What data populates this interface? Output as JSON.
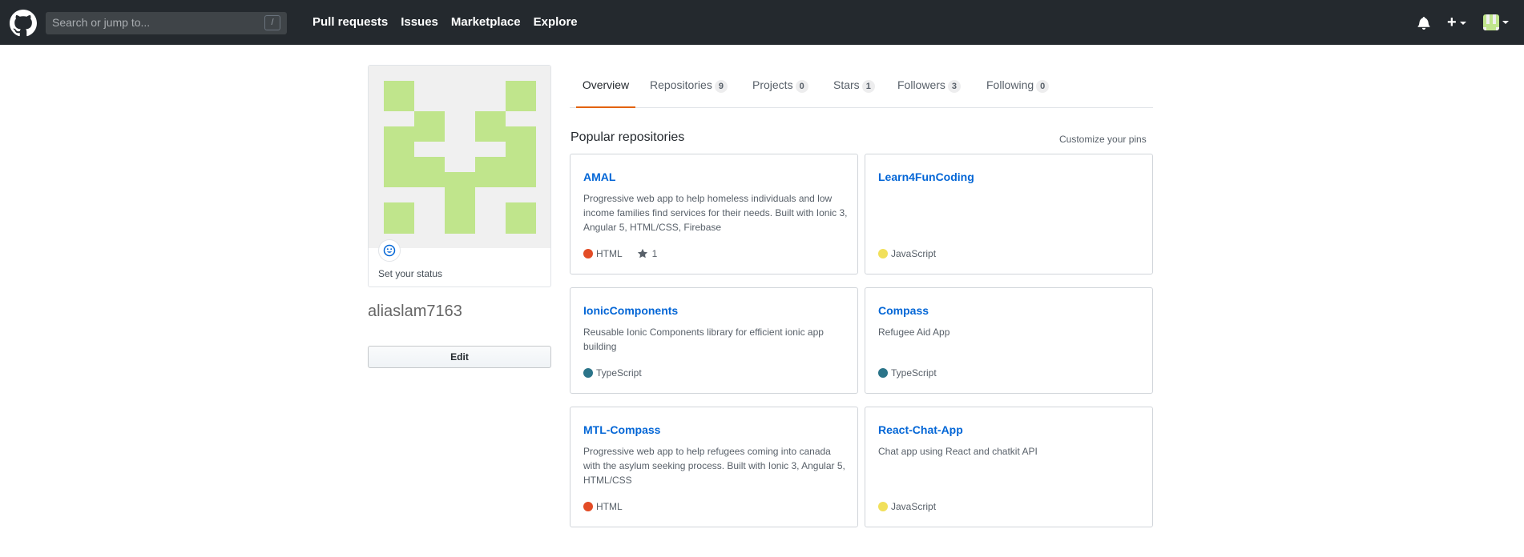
{
  "header": {
    "search_placeholder": "Search or jump to...",
    "search_shortcut": "/",
    "nav": [
      "Pull requests",
      "Issues",
      "Marketplace",
      "Explore"
    ],
    "plus_label": "+"
  },
  "profile": {
    "username": "aliaslam7163",
    "status_label": "Set your status",
    "edit_label": "Edit"
  },
  "tabs": [
    {
      "label": "Overview",
      "count": null
    },
    {
      "label": "Repositories",
      "count": "9"
    },
    {
      "label": "Projects",
      "count": "0"
    },
    {
      "label": "Stars",
      "count": "1"
    },
    {
      "label": "Followers",
      "count": "3"
    },
    {
      "label": "Following",
      "count": "0"
    }
  ],
  "popular": {
    "title": "Popular repositories",
    "customize_label": "Customize your pins",
    "repos": [
      {
        "name": "AMAL",
        "description": "Progressive web app to help homeless individuals and low income families find services for their needs. Built with Ionic 3, Angular 5, HTML/CSS, Firebase",
        "language": "HTML",
        "lang_color": "#e34c26",
        "stars": "1"
      },
      {
        "name": "Learn4FunCoding",
        "description": "",
        "language": "JavaScript",
        "lang_color": "#f1e05a",
        "stars": null
      },
      {
        "name": "IonicComponents",
        "description": "Reusable Ionic Components library for efficient ionic app building",
        "language": "TypeScript",
        "lang_color": "#2b7489",
        "stars": null
      },
      {
        "name": "Compass",
        "description": "Refugee Aid App",
        "language": "TypeScript",
        "lang_color": "#2b7489",
        "stars": null
      },
      {
        "name": "MTL-Compass",
        "description": "Progressive web app to help refugees coming into canada with the asylum seeking process. Built with Ionic 3, Angular 5, HTML/CSS",
        "language": "HTML",
        "lang_color": "#e34c26",
        "stars": null
      },
      {
        "name": "React-Chat-App",
        "description": "Chat app using React and chatkit API",
        "language": "JavaScript",
        "lang_color": "#f1e05a",
        "stars": null
      }
    ]
  },
  "colors": {
    "header_bg": "#24292e",
    "link": "#0366d6",
    "active_tab": "#e36209",
    "identicon": "#c0e58c"
  }
}
